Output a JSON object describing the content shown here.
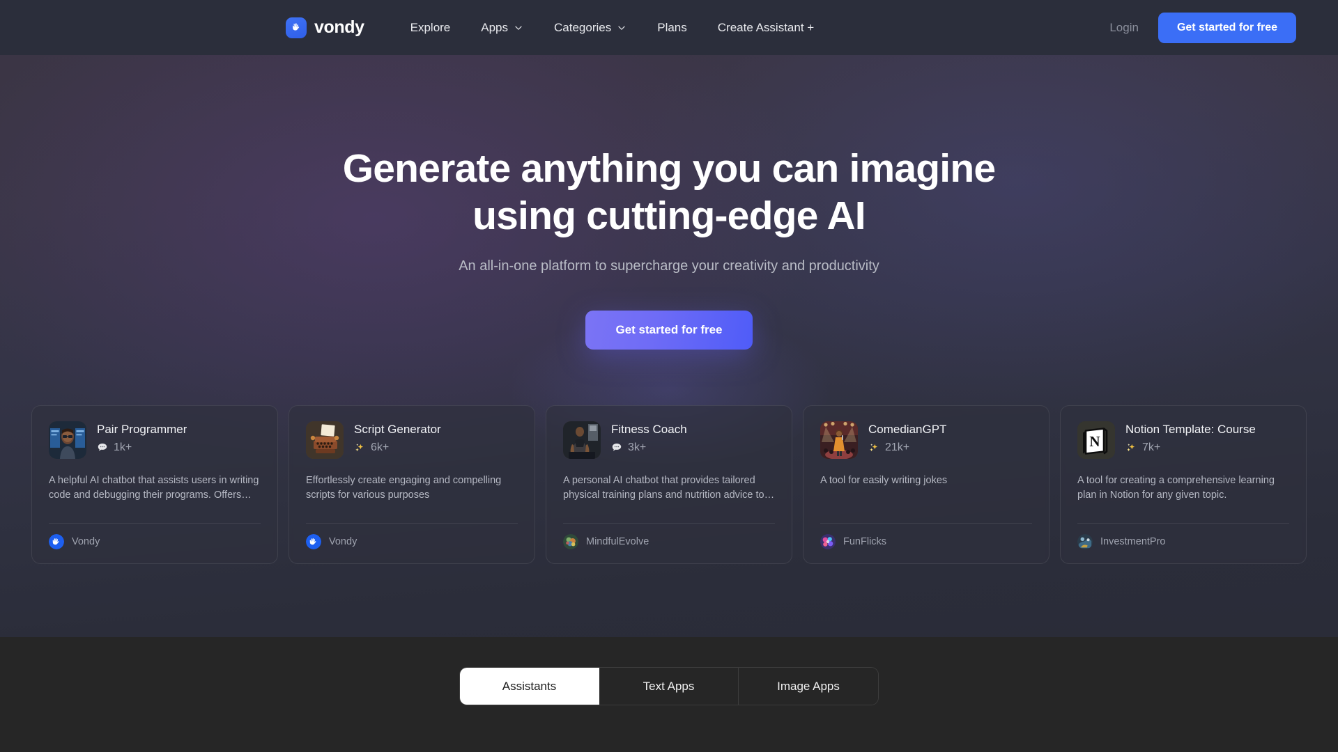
{
  "navbar": {
    "brand": {
      "name": "vondy",
      "icon": "shaka-hand-icon",
      "mark_color": "#3b6ef6"
    },
    "links": [
      {
        "label": "Explore",
        "has_caret": false
      },
      {
        "label": "Apps",
        "has_caret": true
      },
      {
        "label": "Categories",
        "has_caret": true
      },
      {
        "label": "Plans",
        "has_caret": false
      },
      {
        "label": "Create Assistant +",
        "has_caret": false
      }
    ],
    "login_label": "Login",
    "cta_label": "Get started for free",
    "cta_color": "#3b6ef6"
  },
  "hero": {
    "title_line1": "Generate anything you can imagine",
    "title_line2": "using cutting-edge AI",
    "subtitle": "An all-in-one platform to supercharge your creativity and productivity",
    "cta_label": "Get started for free",
    "cta_gradient_from": "#7b74f5",
    "cta_gradient_to": "#4f5cf8"
  },
  "cards": [
    {
      "title": "Pair Programmer",
      "stat_icon": "chat-bubble-icon",
      "stat_value": "1k+",
      "description": "A helpful AI chatbot that assists users in writing code and debugging their programs. Offers cod…",
      "author": "Vondy",
      "author_avatar": "vondy-logo-avatar",
      "thumbnail": "woman-at-computer-thumbnail"
    },
    {
      "title": "Script Generator",
      "stat_icon": "sparkles-icon",
      "stat_value": "6k+",
      "description": "Effortlessly create engaging and compelling scripts for various purposes",
      "author": "Vondy",
      "author_avatar": "vondy-logo-avatar",
      "thumbnail": "typewriter-thumbnail"
    },
    {
      "title": "Fitness Coach",
      "stat_icon": "chat-bubble-icon",
      "stat_value": "3k+",
      "description": "A personal AI chatbot that provides tailored physical training plans and nutrition advice to…",
      "author": "MindfulEvolve",
      "author_avatar": "mindfulevolve-avatar",
      "thumbnail": "athlete-training-thumbnail"
    },
    {
      "title": "ComedianGPT",
      "stat_icon": "sparkles-icon",
      "stat_value": "21k+",
      "description": "A tool for easily writing jokes",
      "author": "FunFlicks",
      "author_avatar": "funflicks-avatar",
      "thumbnail": "comedian-on-stage-thumbnail"
    },
    {
      "title": "Notion Template: Course",
      "stat_icon": "sparkles-icon",
      "stat_value": "7k+",
      "description": "A tool for creating a comprehensive learning plan in Notion for any given topic.",
      "author": "InvestmentPro",
      "author_avatar": "investmentpro-avatar",
      "thumbnail": "notion-logo-thumbnail"
    }
  ],
  "tabs": [
    {
      "label": "Assistants",
      "active": true
    },
    {
      "label": "Text Apps",
      "active": false
    },
    {
      "label": "Image Apps",
      "active": false
    }
  ]
}
